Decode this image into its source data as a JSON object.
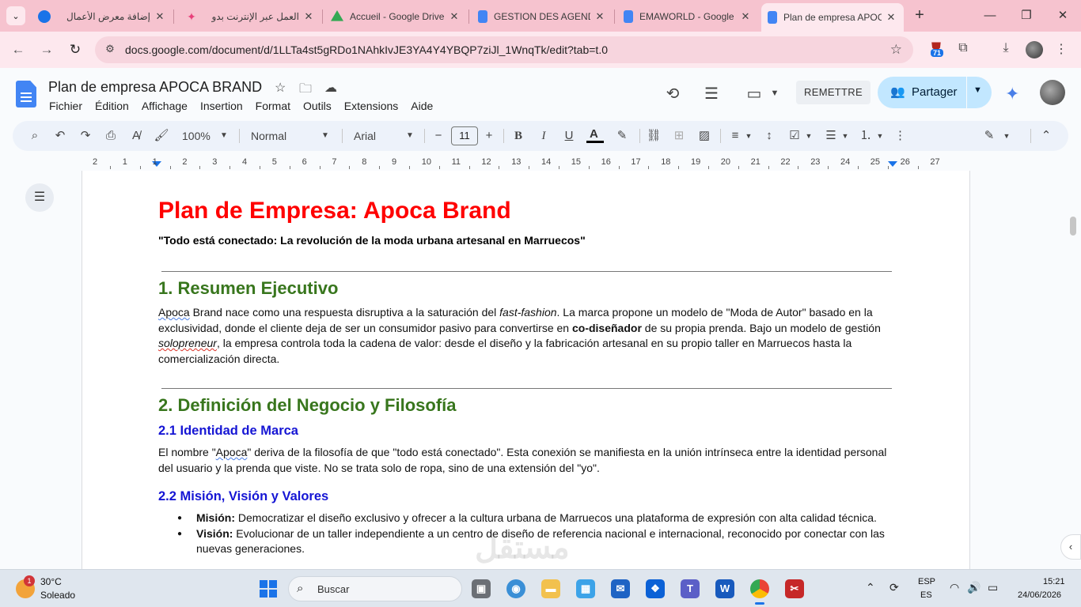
{
  "browser": {
    "tabs": [
      {
        "title": "إضافة معرض الأعمال",
        "color": "#1a73e8"
      },
      {
        "title": "العمل عبر الإنترنت بدو",
        "color": "#e8407a"
      },
      {
        "title": "Accueil - Google Drive",
        "color": "#34a853"
      },
      {
        "title": "GESTION DES AGENDA",
        "color": "#4285f4"
      },
      {
        "title": "EMAWORLD - Google",
        "color": "#4285f4"
      },
      {
        "title": "Plan de empresa APOCA",
        "color": "#4285f4"
      }
    ],
    "url": "docs.google.com/document/d/1LLTa4st5gRDo1NAhkIvJE3YA4Y4YBQP7ziJl_1WnqTk/edit?tab=t.0",
    "extension_badge": "71"
  },
  "docs": {
    "title": "Plan de empresa APOCA BRAND",
    "menu": [
      "Fichier",
      "Édition",
      "Affichage",
      "Insertion",
      "Format",
      "Outils",
      "Extensions",
      "Aide"
    ],
    "remettre_label": "REMETTRE",
    "share_label": "Partager",
    "toolbar": {
      "zoom": "100%",
      "style": "Normal",
      "font": "Arial",
      "font_size": "11"
    },
    "ruler_numbers": [
      "2",
      "1",
      "1",
      "2",
      "3",
      "4",
      "5",
      "6",
      "7",
      "8",
      "9",
      "10",
      "11",
      "12",
      "13",
      "14",
      "15",
      "16",
      "17",
      "18",
      "19",
      "20",
      "21",
      "22",
      "23",
      "24",
      "25",
      "26",
      "27"
    ]
  },
  "document": {
    "title": "Plan de Empresa: Apoca Brand",
    "subtitle": "\"Todo está conectado: La revolución de la moda urbana artesanal en Marruecos\"",
    "s1_heading": "1. Resumen Ejecutivo",
    "s1_p": {
      "a": "Apoca",
      "b": " Brand nace como una respuesta disruptiva a la saturación del ",
      "c": "fast-fashion",
      "d": ". La marca propone un modelo de \"Moda de Autor\" basado en la exclusividad, donde el cliente deja de ser un consumidor pasivo para convertirse en ",
      "e": "co-diseñador",
      "f": " de su propia prenda. Bajo un modelo de gestión ",
      "g": "solopreneur",
      "h": ", la empresa controla toda la cadena de valor: desde el diseño y la fabricación artesanal en su propio taller en Marruecos hasta la comercialización directa."
    },
    "s2_heading": "2. Definición del Negocio y Filosofía",
    "s21_heading": "2.1 Identidad de Marca",
    "s21_p": {
      "a": "El nombre \"",
      "b": "Apoca",
      "c": "\" deriva de la filosofía de que \"todo está conectado\". Esta conexión se manifiesta en la unión intrínseca entre la identidad personal del usuario y la prenda que viste. No se trata solo de ropa, sino de una extensión del \"yo\"."
    },
    "s22_heading": "2.2 Misión, Visión y Valores",
    "bullets": [
      {
        "label": "Misión:",
        "text": " Democratizar el diseño exclusivo y ofrecer a la cultura urbana de Marruecos una plataforma de expresión con alta calidad técnica."
      },
      {
        "label": "Visión:",
        "text": " Evolucionar de un taller independiente a un centro de diseño de referencia nacional e internacional, reconocido por conectar con las nuevas generaciones."
      }
    ]
  },
  "taskbar": {
    "weather_temp": "30°C",
    "weather_desc": "Soleado",
    "weather_badge": "1",
    "search_placeholder": "Buscar",
    "lang_top": "ESP",
    "lang_bottom": "ES",
    "time": "15:21",
    "date": "24/06/2026"
  },
  "watermark": "مستقل"
}
